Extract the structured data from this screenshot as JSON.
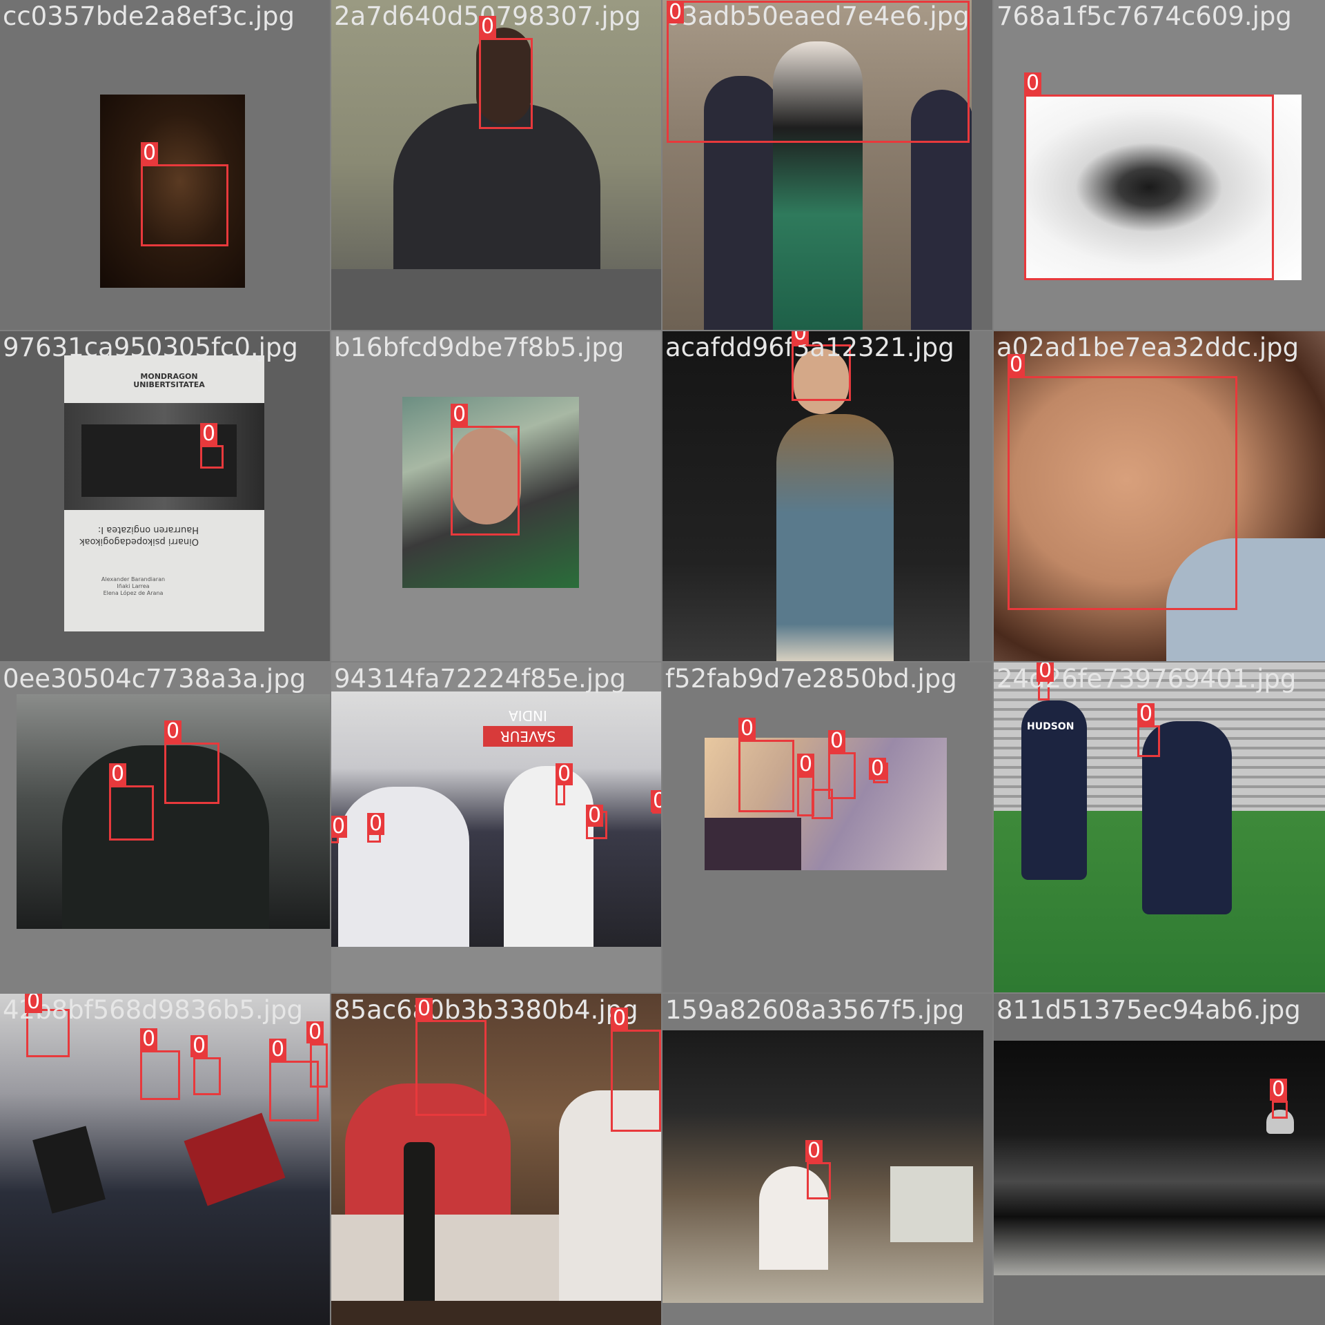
{
  "box_color": "#e8393c",
  "box_label": "0",
  "tiles": [
    {
      "filename": "cc0357bde2a8ef3c.jpg"
    },
    {
      "filename": "2a7d640d50798307.jpg"
    },
    {
      "filename": "03adb50eaed7e4e6.jpg"
    },
    {
      "filename": "768a1f5c7674c609.jpg"
    },
    {
      "filename": "97631ca950305fc0.jpg",
      "doc_text": {
        "logo": "MONDRAGON UNIBERTSITATEA",
        "title": "Haurraren ongizatea I:",
        "subtitle": "Oinarri psikopedagogikoak",
        "authors": [
          "Alexander Barandiaran",
          "Iñaki Larrea",
          "Elena López de Arana"
        ]
      }
    },
    {
      "filename": "b16bfcd9dbe7f8b5.jpg"
    },
    {
      "filename": "acafdd96f3a12321.jpg"
    },
    {
      "filename": "a02ad1be7ea32ddc.jpg"
    },
    {
      "filename": "0ee30504c7738a3a.jpg"
    },
    {
      "filename": "94314fa72224f85e.jpg",
      "sign_text": "SAVEUR INDIA"
    },
    {
      "filename": "f52fab9d7e2850bd.jpg"
    },
    {
      "filename": "24d26fe739769401.jpg",
      "jersey_text": "HUDSON"
    },
    {
      "filename": "42b8bf568d9836b5.jpg"
    },
    {
      "filename": "85ac6a0b3b3380b4.jpg"
    },
    {
      "filename": "159a82608a3567f5.jpg"
    },
    {
      "filename": "811d51375ec94ab6.jpg"
    }
  ]
}
